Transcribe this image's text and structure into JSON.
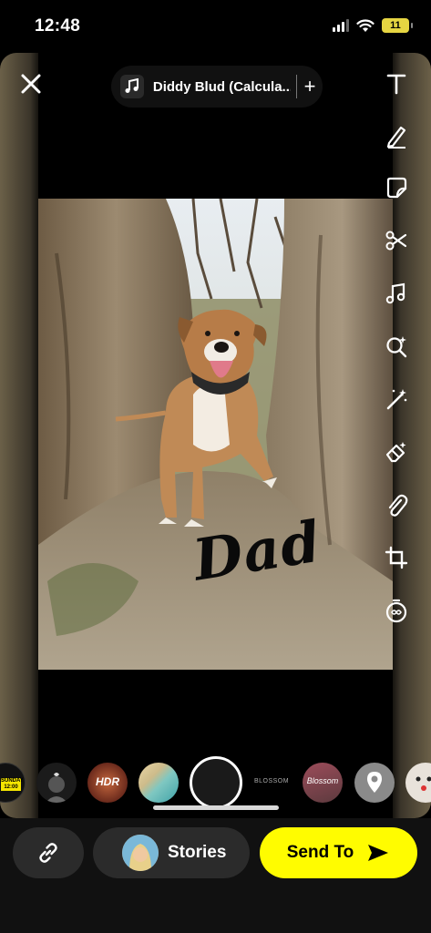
{
  "status_bar": {
    "time": "12:48",
    "battery": "11"
  },
  "header": {
    "music": {
      "title": "Diddy Blud (Calcula...",
      "add_label": "+"
    }
  },
  "toolbar": {
    "tools": [
      "text-icon",
      "pencil-icon",
      "sticker-icon",
      "scissors-icon",
      "music-note-icon",
      "lens-search-icon",
      "magic-wand-icon",
      "eraser-icon",
      "paperclip-icon",
      "crop-icon",
      "timer-icon"
    ]
  },
  "photo": {
    "caption": "Dad"
  },
  "lens_carousel": {
    "items": [
      "SUNDAY",
      "",
      "HDR",
      "",
      "",
      "BLOSSOM",
      "",
      "Blossom",
      "location",
      ""
    ],
    "first_lens_text": "SUNDAY 12:00",
    "hdr_text": "HDR",
    "blossom_text": "Blossom"
  },
  "bottom_bar": {
    "stories_label": "Stories",
    "send_to_label": "Send To"
  },
  "colors": {
    "accent": "#fffc00",
    "button_bg": "#2b2b2b"
  }
}
